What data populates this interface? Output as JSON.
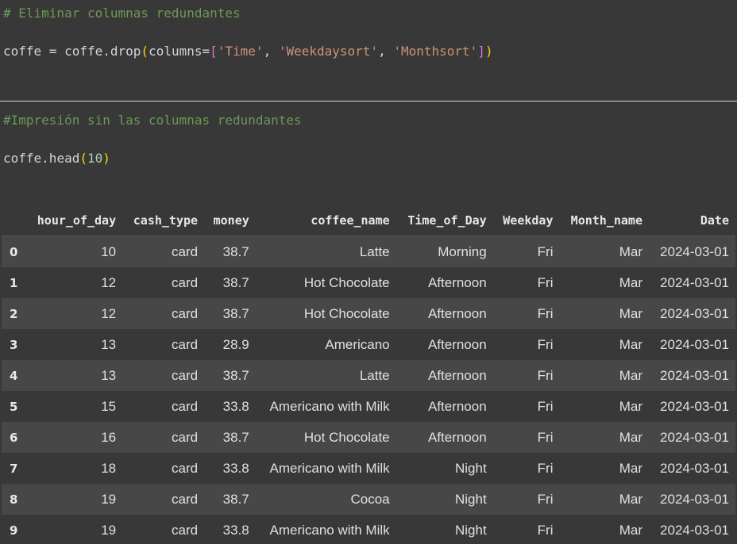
{
  "cells": [
    {
      "comment": "# Eliminar columnas redundantes",
      "code": {
        "var": "coffe",
        "assign": " = ",
        "obj": "coffe",
        "method": ".drop",
        "open_paren": "(",
        "kw": "columns=",
        "open_bracket": "[",
        "args": [
          "'Time'",
          "'Weekdaysort'",
          "'Monthsort'"
        ],
        "sep": ", ",
        "close_bracket": "]",
        "close_paren": ")"
      }
    },
    {
      "comment": "#Impresión sin las columnas redundantes",
      "code": {
        "obj": "coffe",
        "method": ".head",
        "open_paren": "(",
        "arg": "10",
        "close_paren": ")"
      }
    }
  ],
  "table": {
    "index_header": "",
    "columns": [
      "hour_of_day",
      "cash_type",
      "money",
      "coffee_name",
      "Time_of_Day",
      "Weekday",
      "Month_name",
      "Date"
    ],
    "rows": [
      {
        "index": "0",
        "cells": [
          "10",
          "card",
          "38.7",
          "Latte",
          "Morning",
          "Fri",
          "Mar",
          "2024-03-01"
        ]
      },
      {
        "index": "1",
        "cells": [
          "12",
          "card",
          "38.7",
          "Hot Chocolate",
          "Afternoon",
          "Fri",
          "Mar",
          "2024-03-01"
        ]
      },
      {
        "index": "2",
        "cells": [
          "12",
          "card",
          "38.7",
          "Hot Chocolate",
          "Afternoon",
          "Fri",
          "Mar",
          "2024-03-01"
        ]
      },
      {
        "index": "3",
        "cells": [
          "13",
          "card",
          "28.9",
          "Americano",
          "Afternoon",
          "Fri",
          "Mar",
          "2024-03-01"
        ]
      },
      {
        "index": "4",
        "cells": [
          "13",
          "card",
          "38.7",
          "Latte",
          "Afternoon",
          "Fri",
          "Mar",
          "2024-03-01"
        ]
      },
      {
        "index": "5",
        "cells": [
          "15",
          "card",
          "33.8",
          "Americano with Milk",
          "Afternoon",
          "Fri",
          "Mar",
          "2024-03-01"
        ]
      },
      {
        "index": "6",
        "cells": [
          "16",
          "card",
          "38.7",
          "Hot Chocolate",
          "Afternoon",
          "Fri",
          "Mar",
          "2024-03-01"
        ]
      },
      {
        "index": "7",
        "cells": [
          "18",
          "card",
          "33.8",
          "Americano with Milk",
          "Night",
          "Fri",
          "Mar",
          "2024-03-01"
        ]
      },
      {
        "index": "8",
        "cells": [
          "19",
          "card",
          "38.7",
          "Cocoa",
          "Night",
          "Fri",
          "Mar",
          "2024-03-01"
        ]
      },
      {
        "index": "9",
        "cells": [
          "19",
          "card",
          "33.8",
          "Americano with Milk",
          "Night",
          "Fri",
          "Mar",
          "2024-03-01"
        ]
      }
    ]
  },
  "colors": {
    "background": "#383838",
    "row_alt": "#474747",
    "comment": "#6a9955",
    "string": "#ce9178",
    "number": "#b5cea8",
    "bracket_level1": "#ffd700",
    "bracket_level2": "#da70d6"
  }
}
